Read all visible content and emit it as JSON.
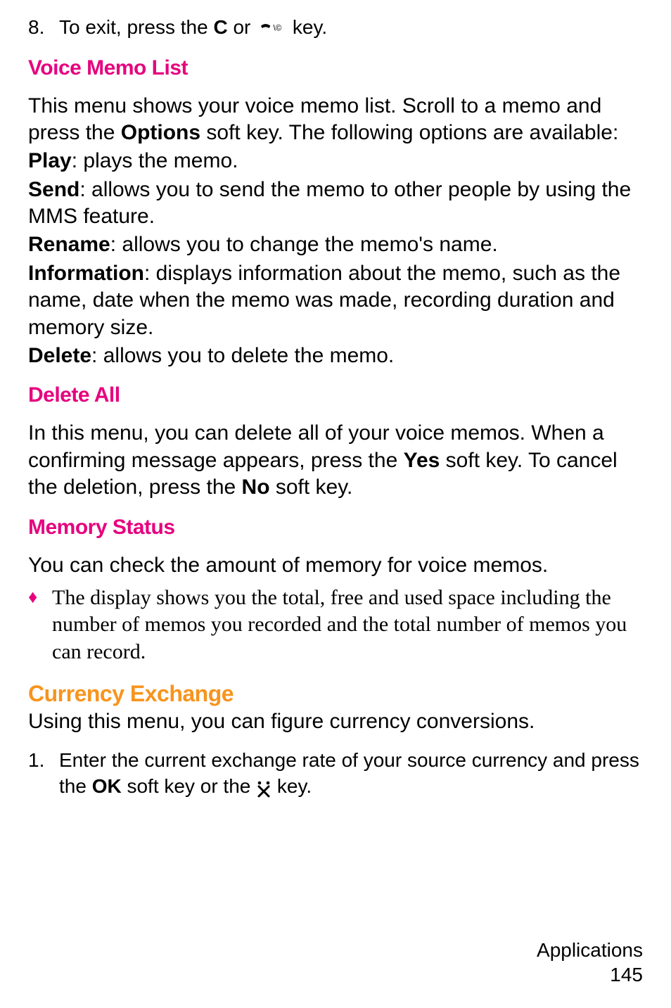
{
  "step8": {
    "num": "8.",
    "text_before": "To exit, press the ",
    "C": "C",
    "text_mid": " or ",
    "text_after": " key."
  },
  "voiceMemoList": {
    "heading": "Voice Memo List",
    "intro_a": "This menu shows your voice memo list. Scroll to a memo and press the ",
    "intro_options": "Options",
    "intro_b": " soft key. The following options are available:",
    "play_label": "Play",
    "play_text": ": plays the memo.",
    "send_label": "Send",
    "send_text": ": allows you to send the memo to other people by using the MMS feature.",
    "rename_label": "Rename",
    "rename_text": ": allows you to change the memo's name.",
    "info_label": "Information",
    "info_text": ": displays information about the memo, such as the name, date when the memo was made, recording duration and memory size.",
    "delete_label": "Delete",
    "delete_text": ": allows you to delete the memo."
  },
  "deleteAll": {
    "heading": "Delete All",
    "text_a": "In this menu, you can delete all of your voice memos. When a confirming message appears, press the ",
    "yes": "Yes",
    "text_b": " soft key. To cancel the deletion, press the ",
    "no": "No",
    "text_c": " soft key."
  },
  "memoryStatus": {
    "heading": "Memory Status",
    "text": "You can check the amount of memory for voice memos.",
    "bullet": "The display shows you the total, free and used space including the number of memos you recorded and the total number of memos you can record."
  },
  "currency": {
    "heading": "Currency Exchange",
    "intro": "Using this menu, you can figure currency conversions.",
    "step1_num": "1.",
    "step1_a": "Enter the current exchange rate of your source currency and press the ",
    "step1_ok": "OK",
    "step1_b": " soft key or the  ",
    "step1_c": "  key."
  },
  "footer": {
    "section": "Applications",
    "page": "145"
  }
}
